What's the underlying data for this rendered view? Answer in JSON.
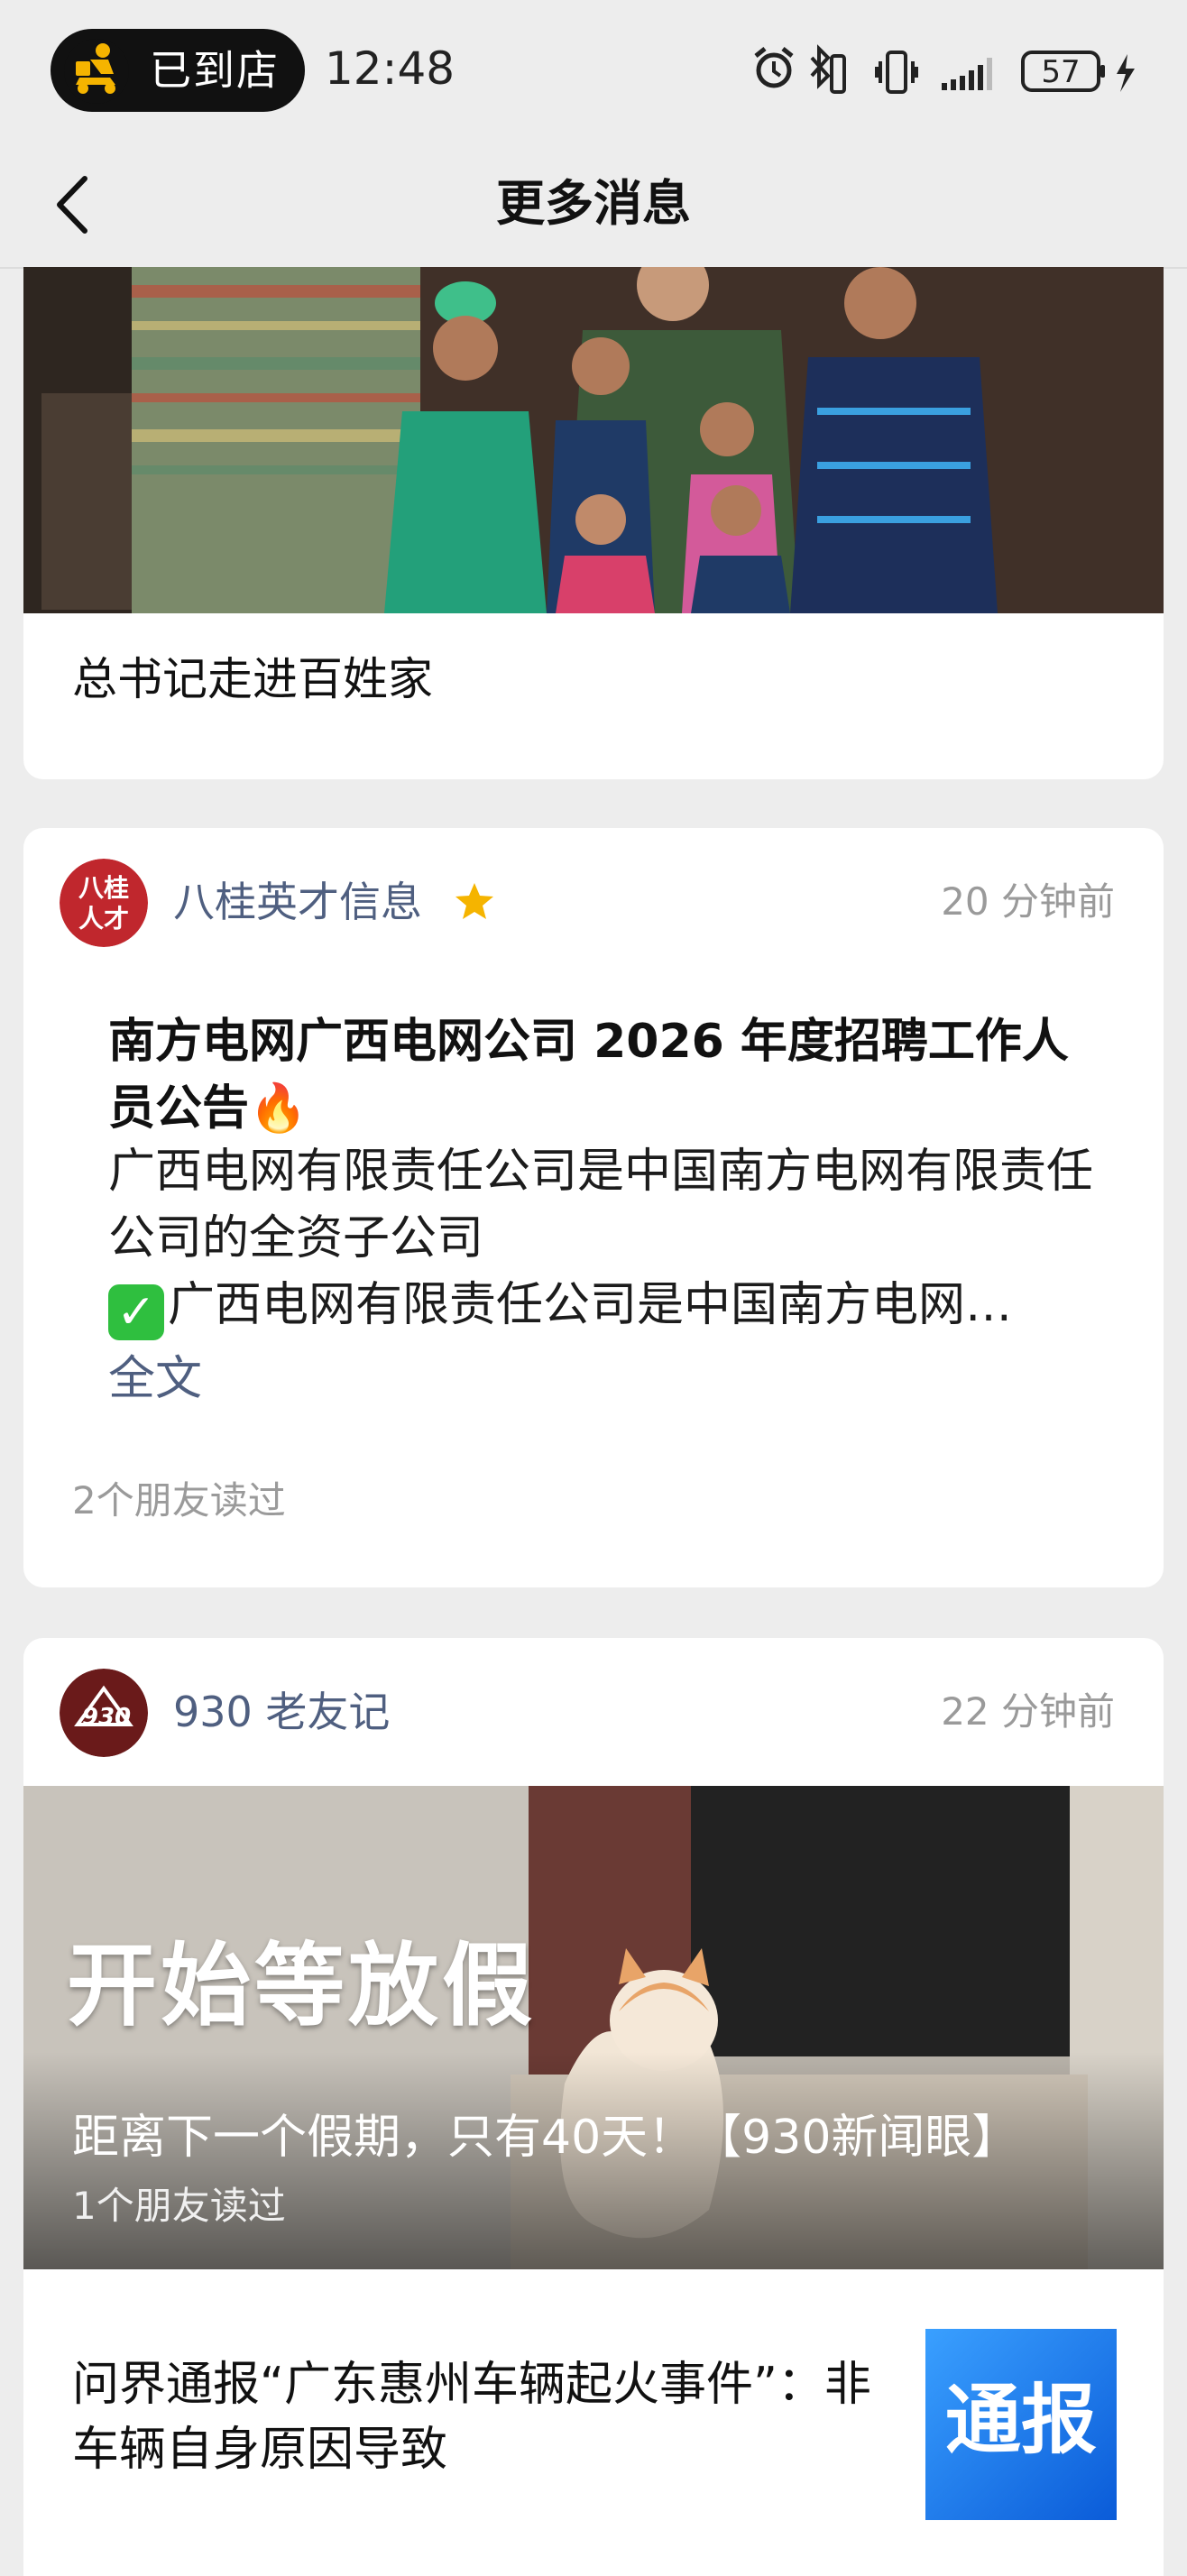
{
  "status_bar": {
    "pill_label": "已到店",
    "time": "12:48",
    "battery": "57"
  },
  "navbar": {
    "title": "更多消息"
  },
  "cards": [
    {
      "title": "总书记走进百姓家"
    },
    {
      "avatar_text_line1": "八桂",
      "avatar_text_line2": "人才",
      "account": "八桂英才信息",
      "time": "20 分钟前",
      "title": "南方电网广西电网公司 2026 年度招聘工作人员公告🔥",
      "body_line1": "广西电网有限责任公司是中国南方电网有限责任公司的全资子公司",
      "body_line2": "广西电网有限责任公司是中国南方电网…",
      "link": "全文",
      "read_by": "2个朋友读过"
    },
    {
      "avatar_text": "930",
      "account": "930 老友记",
      "time": "22 分钟前",
      "image_caption": "开始等放假",
      "image_title": "距离下一个假期，只有40天！【930新闻眼】",
      "image_read_by": "1个朋友读过",
      "news_title": "问界通报“广东惠州车辆起火事件”：非车辆自身原因导致",
      "thumb_text": "通报"
    }
  ],
  "colors": {
    "background": "#ededed",
    "link": "#4f5f80",
    "meta": "#9a9a9a"
  }
}
